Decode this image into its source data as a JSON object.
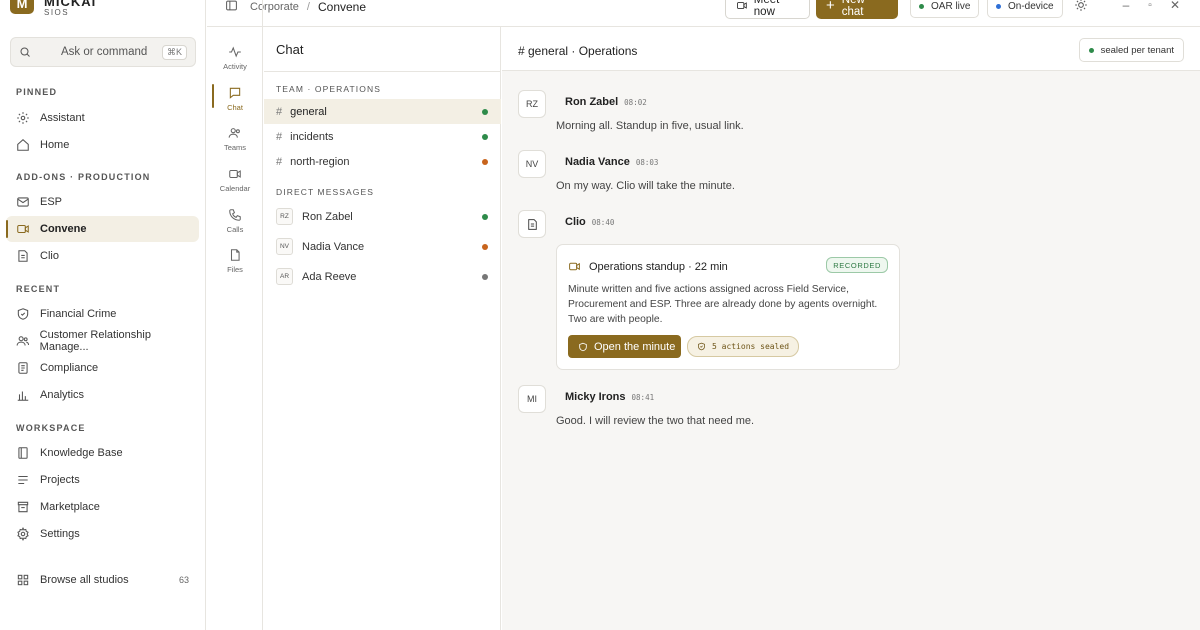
{
  "brand": {
    "logo_letter": "M",
    "name": "MICKAI",
    "sub": "SIOS"
  },
  "sidebar": {
    "search": {
      "placeholder": "Ask or command",
      "shortcut": "⌘K"
    },
    "sections": {
      "pinned": "PINNED",
      "addons": "ADD-ONS · PRODUCTION",
      "recent": "RECENT",
      "workspace": "WORKSPACE"
    },
    "pinned": [
      {
        "label": "Assistant",
        "icon": "sparkle-icon"
      },
      {
        "label": "Home",
        "icon": "home-icon"
      }
    ],
    "addons": [
      {
        "label": "ESP",
        "icon": "mail-icon"
      },
      {
        "label": "Convene",
        "icon": "video-icon"
      },
      {
        "label": "Clio",
        "icon": "document-icon"
      }
    ],
    "recent": [
      {
        "label": "Financial Crime",
        "icon": "shield-icon"
      },
      {
        "label": "Customer Relationship Manage...",
        "icon": "users-icon"
      },
      {
        "label": "Compliance",
        "icon": "clipboard-icon"
      },
      {
        "label": "Analytics",
        "icon": "bar-chart-icon"
      }
    ],
    "workspace": [
      {
        "label": "Knowledge Base",
        "icon": "book-icon"
      },
      {
        "label": "Projects",
        "icon": "list-icon"
      },
      {
        "label": "Marketplace",
        "icon": "store-icon"
      },
      {
        "label": "Settings",
        "icon": "gear-icon"
      }
    ],
    "browse": {
      "label": "Browse all studios",
      "count": "63"
    }
  },
  "rail": {
    "items": [
      {
        "label": "Activity"
      },
      {
        "label": "Chat"
      },
      {
        "label": "Teams"
      },
      {
        "label": "Calendar"
      },
      {
        "label": "Calls"
      },
      {
        "label": "Files"
      }
    ]
  },
  "topbar": {
    "breadcrumb": {
      "parent": "Corporate",
      "separator": "/",
      "current": "Convene"
    },
    "meet_label": "Meet now",
    "new_chat_label": "New chat",
    "oar_label": "OAR live",
    "device_label": "On-device"
  },
  "chatlist": {
    "title": "Chat",
    "team_section": "TEAM · OPERATIONS",
    "dm_section": "DIRECT MESSAGES",
    "hash": "#",
    "channels": [
      {
        "name": "general",
        "status_color": "#2e8b4a"
      },
      {
        "name": "incidents",
        "status_color": "#2e8b4a"
      },
      {
        "name": "north-region",
        "status_color": "#c8641c"
      }
    ],
    "dms": [
      {
        "initials": "RZ",
        "name": "Ron Zabel",
        "status_color": "#2e8b4a"
      },
      {
        "initials": "NV",
        "name": "Nadia Vance",
        "status_color": "#c8641c"
      },
      {
        "initials": "AR",
        "name": "Ada Reeve",
        "status_color": "#777777"
      }
    ]
  },
  "main": {
    "title": "# general · Operations",
    "sealed_label": "sealed per tenant",
    "messages": [
      {
        "initials": "RZ",
        "name": "Ron Zabel",
        "time": "08:02",
        "text": "Morning all. Standup in five, usual link."
      },
      {
        "initials": "NV",
        "name": "Nadia Vance",
        "time": "08:03",
        "text": "On my way. Clio will take the minute."
      },
      {
        "name": "Clio",
        "time": "08:40"
      },
      {
        "initials": "MI",
        "name": "Micky Irons",
        "time": "08:41",
        "text": "Good. I will review the two that need me."
      }
    ],
    "card": {
      "title": "Operations standup · 22 min",
      "badge": "RECORDED",
      "body": "Minute written and five actions assigned across Field Service, Procurement and ESP. Three are already done by agents overnight. Two are with people.",
      "button_label": "Open the minute",
      "actions_label": "5 actions sealed"
    }
  },
  "colors": {
    "accent": "#8a6a1f",
    "green": "#2e8b4a",
    "orange": "#c8641c",
    "blue": "#2f6fd6"
  }
}
